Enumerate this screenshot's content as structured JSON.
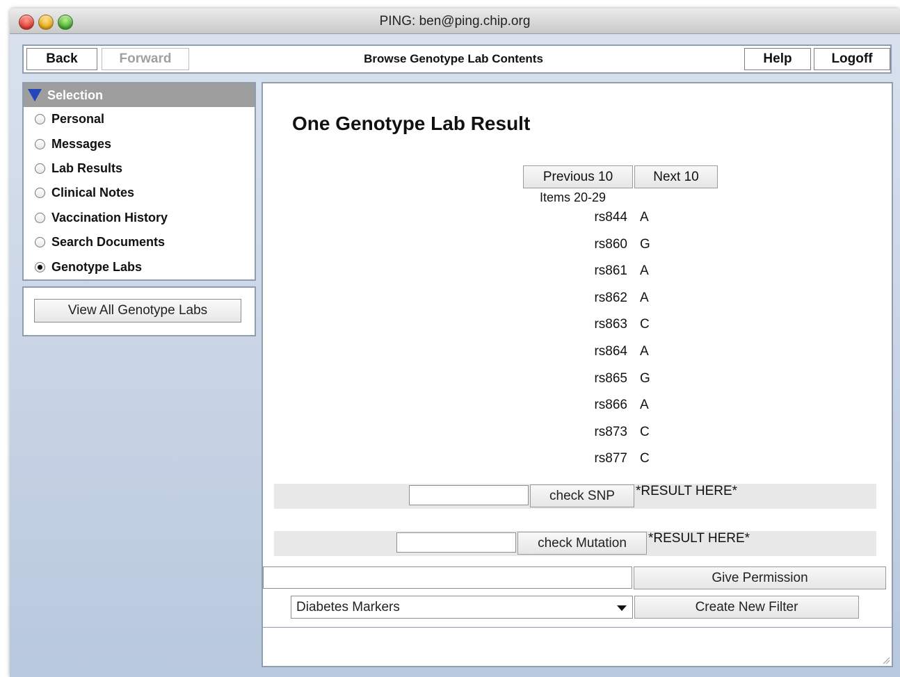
{
  "window": {
    "title": "PING: ben@ping.chip.org"
  },
  "toolbar": {
    "back_label": "Back",
    "forward_label": "Forward",
    "title": "Browse Genotype Lab Contents",
    "help_label": "Help",
    "logoff_label": "Logoff"
  },
  "selection": {
    "header": "Selection",
    "items": [
      {
        "label": "Personal",
        "selected": false
      },
      {
        "label": "Messages",
        "selected": false
      },
      {
        "label": "Lab Results",
        "selected": false
      },
      {
        "label": "Clinical Notes",
        "selected": false
      },
      {
        "label": "Vaccination History",
        "selected": false
      },
      {
        "label": "Search Documents",
        "selected": false
      },
      {
        "label": "Genotype Labs",
        "selected": true
      }
    ],
    "view_all_label": "View All Genotype Labs"
  },
  "main": {
    "title": "One Genotype Lab Result",
    "previous_label": "Previous 10",
    "next_label": "Next 10",
    "items_range": "Items 20-29",
    "snps": [
      {
        "id": "rs844",
        "allele": "A"
      },
      {
        "id": "rs860",
        "allele": "G"
      },
      {
        "id": "rs861",
        "allele": "A"
      },
      {
        "id": "rs862",
        "allele": "A"
      },
      {
        "id": "rs863",
        "allele": "C"
      },
      {
        "id": "rs864",
        "allele": "A"
      },
      {
        "id": "rs865",
        "allele": "G"
      },
      {
        "id": "rs866",
        "allele": "A"
      },
      {
        "id": "rs873",
        "allele": "C"
      },
      {
        "id": "rs877",
        "allele": "C"
      }
    ],
    "check_snp_label": "check SNP",
    "snp_result": "*RESULT HERE*",
    "snp_input_value": "",
    "check_mutation_label": "check Mutation",
    "mutation_result": "*RESULT HERE*",
    "mutation_input_value": "",
    "permission_input_value": "",
    "give_permission_label": "Give Permission",
    "filter_selected": "Diabetes Markers",
    "create_filter_label": "Create New Filter"
  }
}
